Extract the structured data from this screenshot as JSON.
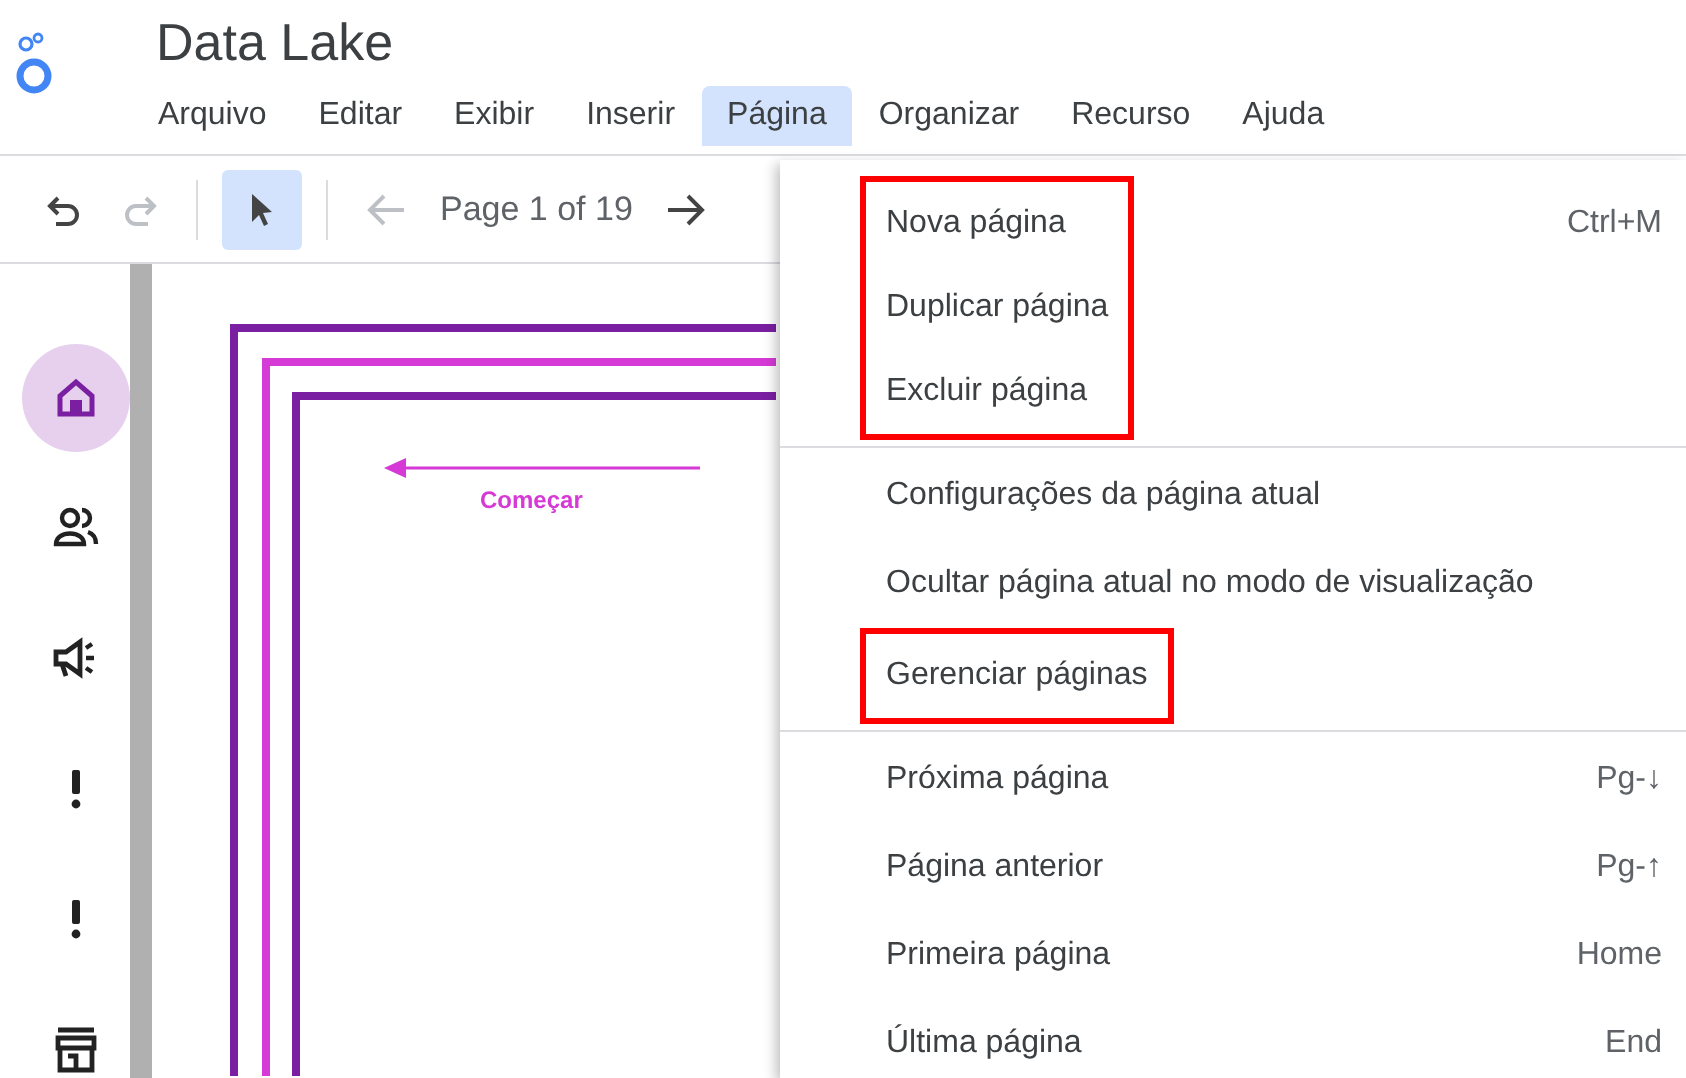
{
  "app": {
    "title": "Data Lake"
  },
  "menu_bar": [
    {
      "label": "Arquivo",
      "selected": false
    },
    {
      "label": "Editar",
      "selected": false
    },
    {
      "label": "Exibir",
      "selected": false
    },
    {
      "label": "Inserir",
      "selected": false
    },
    {
      "label": "Página",
      "selected": true
    },
    {
      "label": "Organizar",
      "selected": false
    },
    {
      "label": "Recurso",
      "selected": false
    },
    {
      "label": "Ajuda",
      "selected": false
    }
  ],
  "toolbar": {
    "history": [
      {
        "kind": "undo",
        "disabled": false
      },
      {
        "kind": "redo",
        "disabled": true
      }
    ],
    "select_tool": {
      "selected": true
    },
    "prev_page": {
      "disabled": true
    },
    "page_indicator": "Page 1 of 19",
    "next_page": {
      "disabled": false
    }
  },
  "rail": [
    {
      "kind": "home",
      "selected": true
    },
    {
      "kind": "people",
      "selected": false
    },
    {
      "kind": "megaphone",
      "selected": false
    },
    {
      "kind": "alert",
      "selected": false
    },
    {
      "kind": "alert",
      "selected": false
    },
    {
      "kind": "store",
      "selected": false
    }
  ],
  "canvas": {
    "arrow_label": "Começar"
  },
  "dropdown": {
    "sections": [
      {
        "blocks": [
          {
            "highlighted": true,
            "items": [
              {
                "label": "Nova página",
                "shortcut": "Ctrl+M"
              },
              {
                "label": "Duplicar página"
              },
              {
                "label": "Excluir página"
              }
            ]
          }
        ]
      },
      {
        "blocks": [
          {
            "highlighted": false,
            "items": [
              {
                "label": "Configurações da página atual"
              },
              {
                "label": "Ocultar página atual no modo de visualização"
              }
            ]
          },
          {
            "highlighted": true,
            "items": [
              {
                "label": "Gerenciar páginas"
              }
            ]
          }
        ]
      },
      {
        "blocks": [
          {
            "highlighted": false,
            "items": [
              {
                "label": "Próxima página",
                "shortcut": "Pg-↓"
              },
              {
                "label": "Página anterior",
                "shortcut": "Pg-↑"
              },
              {
                "label": "Primeira página",
                "shortcut": "Home"
              },
              {
                "label": "Última página",
                "shortcut": "End"
              }
            ]
          }
        ]
      }
    ]
  }
}
